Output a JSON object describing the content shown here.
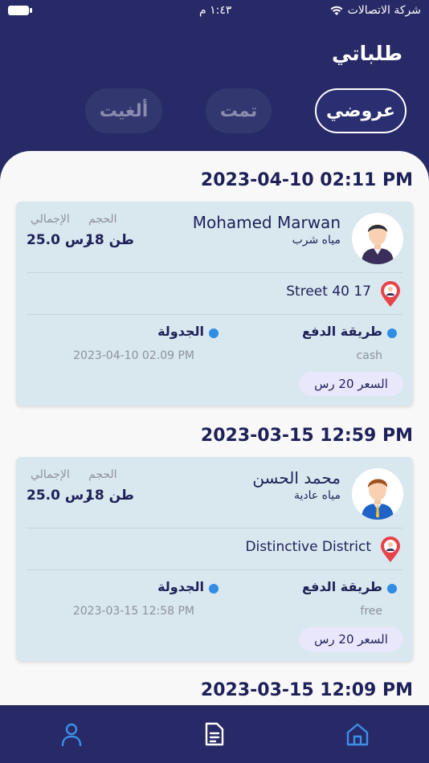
{
  "status_bar": {
    "carrier": "شركة الاتصالات",
    "time": "١:٤٣ م"
  },
  "header": {
    "title": "طلباتي"
  },
  "tabs": [
    {
      "label": "عروضي",
      "active": true
    },
    {
      "label": "تمت",
      "active": false
    },
    {
      "label": "ألغيت",
      "active": false
    }
  ],
  "orders": [
    {
      "date": "2023-04-10 02:11 PM",
      "customer": {
        "name": "Mohamed Marwan",
        "product": "مياه شرب"
      },
      "volume_label": "الحجم",
      "volume_value": "18 طن",
      "total_label": "الإجمالي",
      "total_value": "25.0 رس",
      "address": "Street 40 17",
      "payment_label": "طريقة الدفع",
      "payment_value": "cash",
      "schedule_label": "الجدولة",
      "schedule_value": "2023-04-10 02.09 PM",
      "price_label": "السعر  20 رس"
    },
    {
      "date": "2023-03-15 12:59 PM",
      "customer": {
        "name": "محمد الحسن",
        "product": "مياه عادية"
      },
      "volume_label": "الحجم",
      "volume_value": "18 طن",
      "total_label": "الإجمالي",
      "total_value": "25.0 رس",
      "address": "Distinctive District",
      "payment_label": "طريقة الدفع",
      "payment_value": "free",
      "schedule_label": "الجدولة",
      "schedule_value": "2023-03-15 12:58 PM",
      "price_label": "السعر  20 رس"
    }
  ],
  "next_date": "2023-03-15 12:09 PM",
  "nav": [
    {
      "icon": "profile-icon"
    },
    {
      "icon": "orders-icon"
    },
    {
      "icon": "home-icon"
    }
  ],
  "colors": {
    "primary": "#272a66",
    "accent": "#2f8de4",
    "card": "#d9e7ef",
    "pin": "#e8424a"
  }
}
